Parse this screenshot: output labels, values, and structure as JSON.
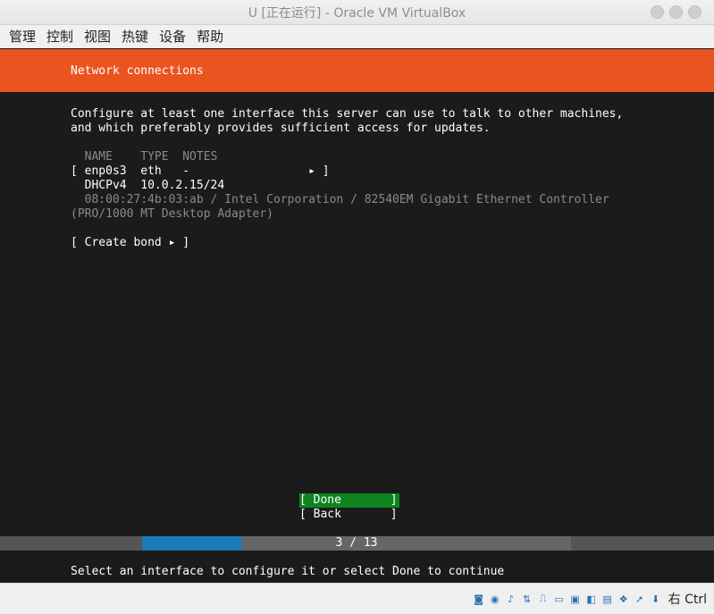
{
  "window": {
    "title": "U [正在运行] - Oracle VM VirtualBox"
  },
  "menu": {
    "items": [
      "管理",
      "控制",
      "视图",
      "热键",
      "设备",
      "帮助"
    ]
  },
  "installer": {
    "header_title": "Network connections",
    "description_line1": "Configure at least one interface this server can use to talk to other machines,",
    "description_line2": "and which preferably provides sufficient access for updates.",
    "table_header": "  NAME    TYPE  NOTES",
    "interface_row": "[ enp0s3  eth   -                 ▸ ]",
    "dhcp_row": "  DHCPv4  10.0.2.15/24",
    "hw_line1": "  08:00:27:4b:03:ab / Intel Corporation / 82540EM Gigabit Ethernet Controller",
    "hw_line2": "(PRO/1000 MT Desktop Adapter)",
    "create_bond": "[ Create bond ▸ ]",
    "done_button": "[ Done       ]",
    "back_button": "[ Back       ]",
    "progress": {
      "current": 3,
      "total": 13,
      "label": "3 / 13"
    },
    "status_line": "Select an interface to configure it or select Done to continue"
  },
  "statusbar": {
    "icons": [
      "hard-disk-icon",
      "optical-drive-icon",
      "audio-icon",
      "network-icon",
      "usb-icon",
      "shared-folder-icon",
      "display-icon",
      "snapshot-icon",
      "video-capture-icon",
      "guest-additions-icon",
      "mouse-integration-icon",
      "keyboard-capture-icon"
    ],
    "host_key": "右 Ctrl"
  },
  "colors": {
    "accent": "#e95420",
    "selected": "#0e8420",
    "progress": "#1a7ab8"
  }
}
